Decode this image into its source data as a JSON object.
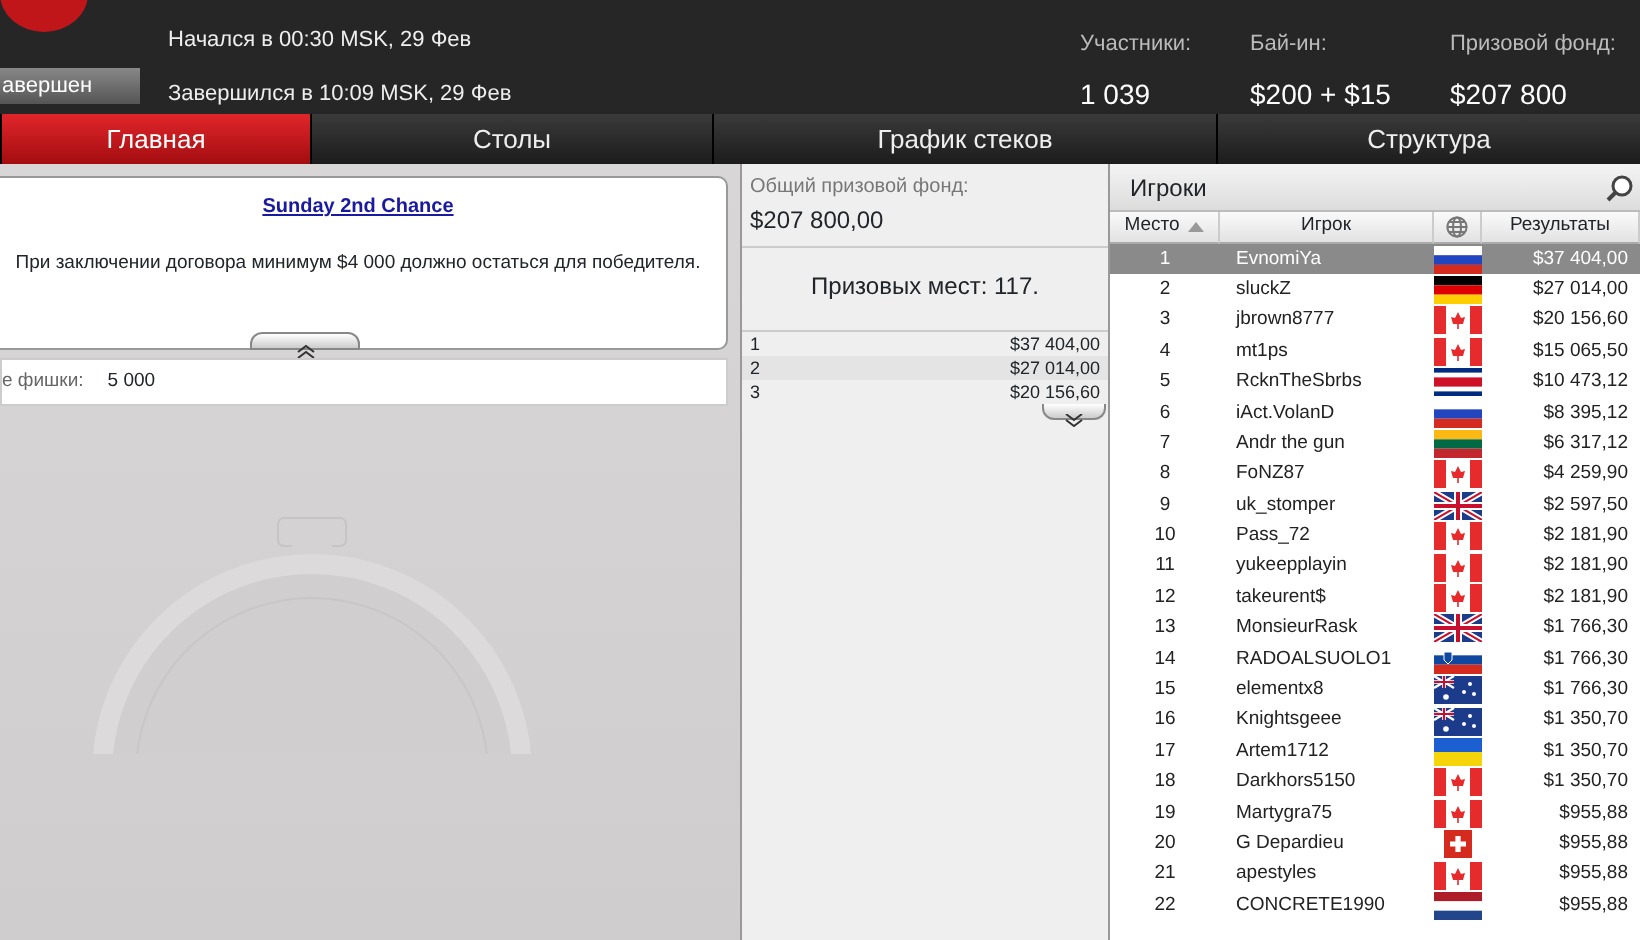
{
  "header": {
    "status_label": "авершен",
    "started": "Начался в 00:30 MSK, 29 Фев",
    "finished": "Завершился в 10:09 MSK, 29 Фев",
    "stats": [
      {
        "label": "Участники:",
        "value": "1 039"
      },
      {
        "label": "Бай-ин:",
        "value": "$200 + $15"
      },
      {
        "label": "Призовой фонд:",
        "value": "$207 800"
      }
    ]
  },
  "tabs": [
    {
      "label": "Главная",
      "selected": true
    },
    {
      "label": "Столы",
      "selected": false
    },
    {
      "label": "График стеков",
      "selected": false
    },
    {
      "label": "Структура",
      "selected": false
    }
  ],
  "info": {
    "title": "Sunday 2nd Chance",
    "note": "При заключении договора минимум $4 000 должно остаться для победителя.",
    "chips_label": "е фишки:",
    "chips_value": "5 000"
  },
  "prizes": {
    "pool_label": "Общий призовой фонд:",
    "pool_value": "$207 800,00",
    "places": "Призовых мест: 117.",
    "rows": [
      {
        "place": "1",
        "amount": "$37 404,00"
      },
      {
        "place": "2",
        "amount": "$27 014,00"
      },
      {
        "place": "3",
        "amount": "$20 156,60"
      }
    ]
  },
  "players": {
    "title": "Игроки",
    "columns": [
      "Место",
      "Игрок",
      "Результаты"
    ],
    "rows": [
      {
        "place": "1",
        "name": "EvnomiYa",
        "kind": "russia",
        "result": "$37 404,00",
        "selected": true
      },
      {
        "place": "2",
        "name": "sluckZ",
        "kind": "germany",
        "result": "$27 014,00",
        "selected": false
      },
      {
        "place": "3",
        "name": "jbrown8777",
        "kind": "canada",
        "result": "$20 156,60",
        "selected": false
      },
      {
        "place": "4",
        "name": "mt1ps",
        "kind": "canada",
        "result": "$15 065,50",
        "selected": false
      },
      {
        "place": "5",
        "name": "RcknTheSbrbs",
        "kind": "costarica",
        "result": "$10 473,12",
        "selected": false
      },
      {
        "place": "6",
        "name": "iAct.VolanD",
        "kind": "russia",
        "result": "$8 395,12",
        "selected": false
      },
      {
        "place": "7",
        "name": "Andr the gun",
        "kind": "lithuania",
        "result": "$6 317,12",
        "selected": false
      },
      {
        "place": "8",
        "name": "FoNZ87",
        "kind": "canada",
        "result": "$4 259,90",
        "selected": false
      },
      {
        "place": "9",
        "name": "uk_stomper",
        "kind": "uk",
        "result": "$2 597,50",
        "selected": false
      },
      {
        "place": "10",
        "name": "Pass_72",
        "kind": "canada",
        "result": "$2 181,90",
        "selected": false
      },
      {
        "place": "11",
        "name": "yukeepplayin",
        "kind": "canada",
        "result": "$2 181,90",
        "selected": false
      },
      {
        "place": "12",
        "name": "takeurent$",
        "kind": "canada",
        "result": "$2 181,90",
        "selected": false
      },
      {
        "place": "13",
        "name": "MonsieurRask",
        "kind": "uk",
        "result": "$1 766,30",
        "selected": false
      },
      {
        "place": "14",
        "name": "RADOALSUOLO1",
        "kind": "slovenia",
        "result": "$1 766,30",
        "selected": false
      },
      {
        "place": "15",
        "name": "elementx8",
        "kind": "australia",
        "result": "$1 766,30",
        "selected": false
      },
      {
        "place": "16",
        "name": "Knightsgeee",
        "kind": "australia",
        "result": "$1 350,70",
        "selected": false
      },
      {
        "place": "17",
        "name": "Artem1712",
        "kind": "ukraine",
        "result": "$1 350,70",
        "selected": false
      },
      {
        "place": "18",
        "name": "Darkhors5150",
        "kind": "canada",
        "result": "$1 350,70",
        "selected": false
      },
      {
        "place": "19",
        "name": "Martygra75",
        "kind": "canada",
        "result": "$955,88",
        "selected": false
      },
      {
        "place": "20",
        "name": "G Depardieu",
        "kind": "switzerland",
        "result": "$955,88",
        "selected": false
      },
      {
        "place": "21",
        "name": "apestyles",
        "kind": "canada",
        "result": "$955,88",
        "selected": false
      },
      {
        "place": "22",
        "name": "CONCRETE1990",
        "kind": "netherlands",
        "result": "$955,88",
        "selected": false
      }
    ]
  }
}
